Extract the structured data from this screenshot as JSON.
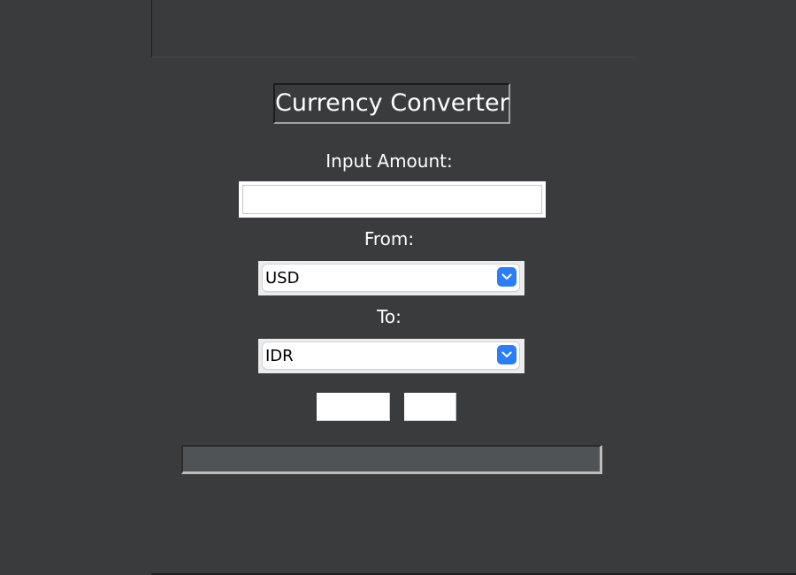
{
  "title": "Currency Converter",
  "amount": {
    "label": "Input Amount:",
    "value": ""
  },
  "from": {
    "label": "From:",
    "selected": "USD"
  },
  "to": {
    "label": "To:",
    "selected": "IDR"
  },
  "buttons": {
    "convert_label": "",
    "clear_label": ""
  },
  "result": {
    "text": ""
  },
  "colors": {
    "background": "#3a3b3d",
    "select_accent": "#2c7ef8",
    "result_bg": "#4f5356"
  },
  "icons": {
    "select_arrow": "chevron-down-icon"
  }
}
